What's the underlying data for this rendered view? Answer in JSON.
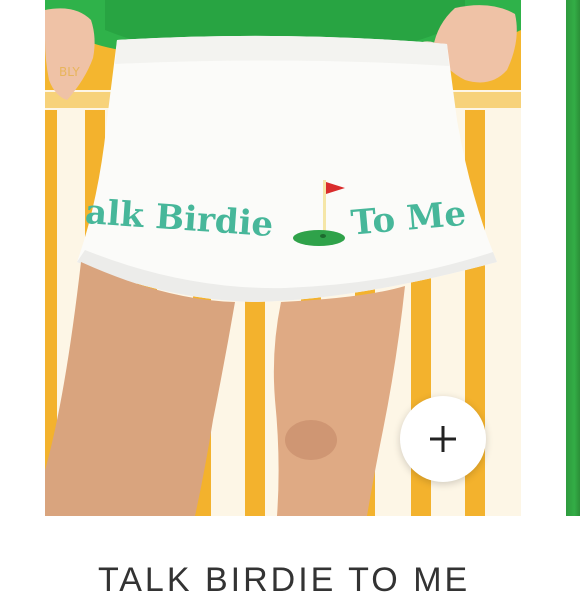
{
  "product": {
    "title": "TALK BIRDIE TO ME",
    "print_text_left": "alk Birdie",
    "print_text_right": "To Me",
    "waistband_tag": "BLY"
  },
  "actions": {
    "add_icon": "plus-icon"
  },
  "colors": {
    "sweater_green": "#2fb24a",
    "print_teal": "#47b79a",
    "skirt_white": "#fbfbf9",
    "stripe_yellow": "#f4b62f",
    "flag_red": "#d92c2c"
  }
}
